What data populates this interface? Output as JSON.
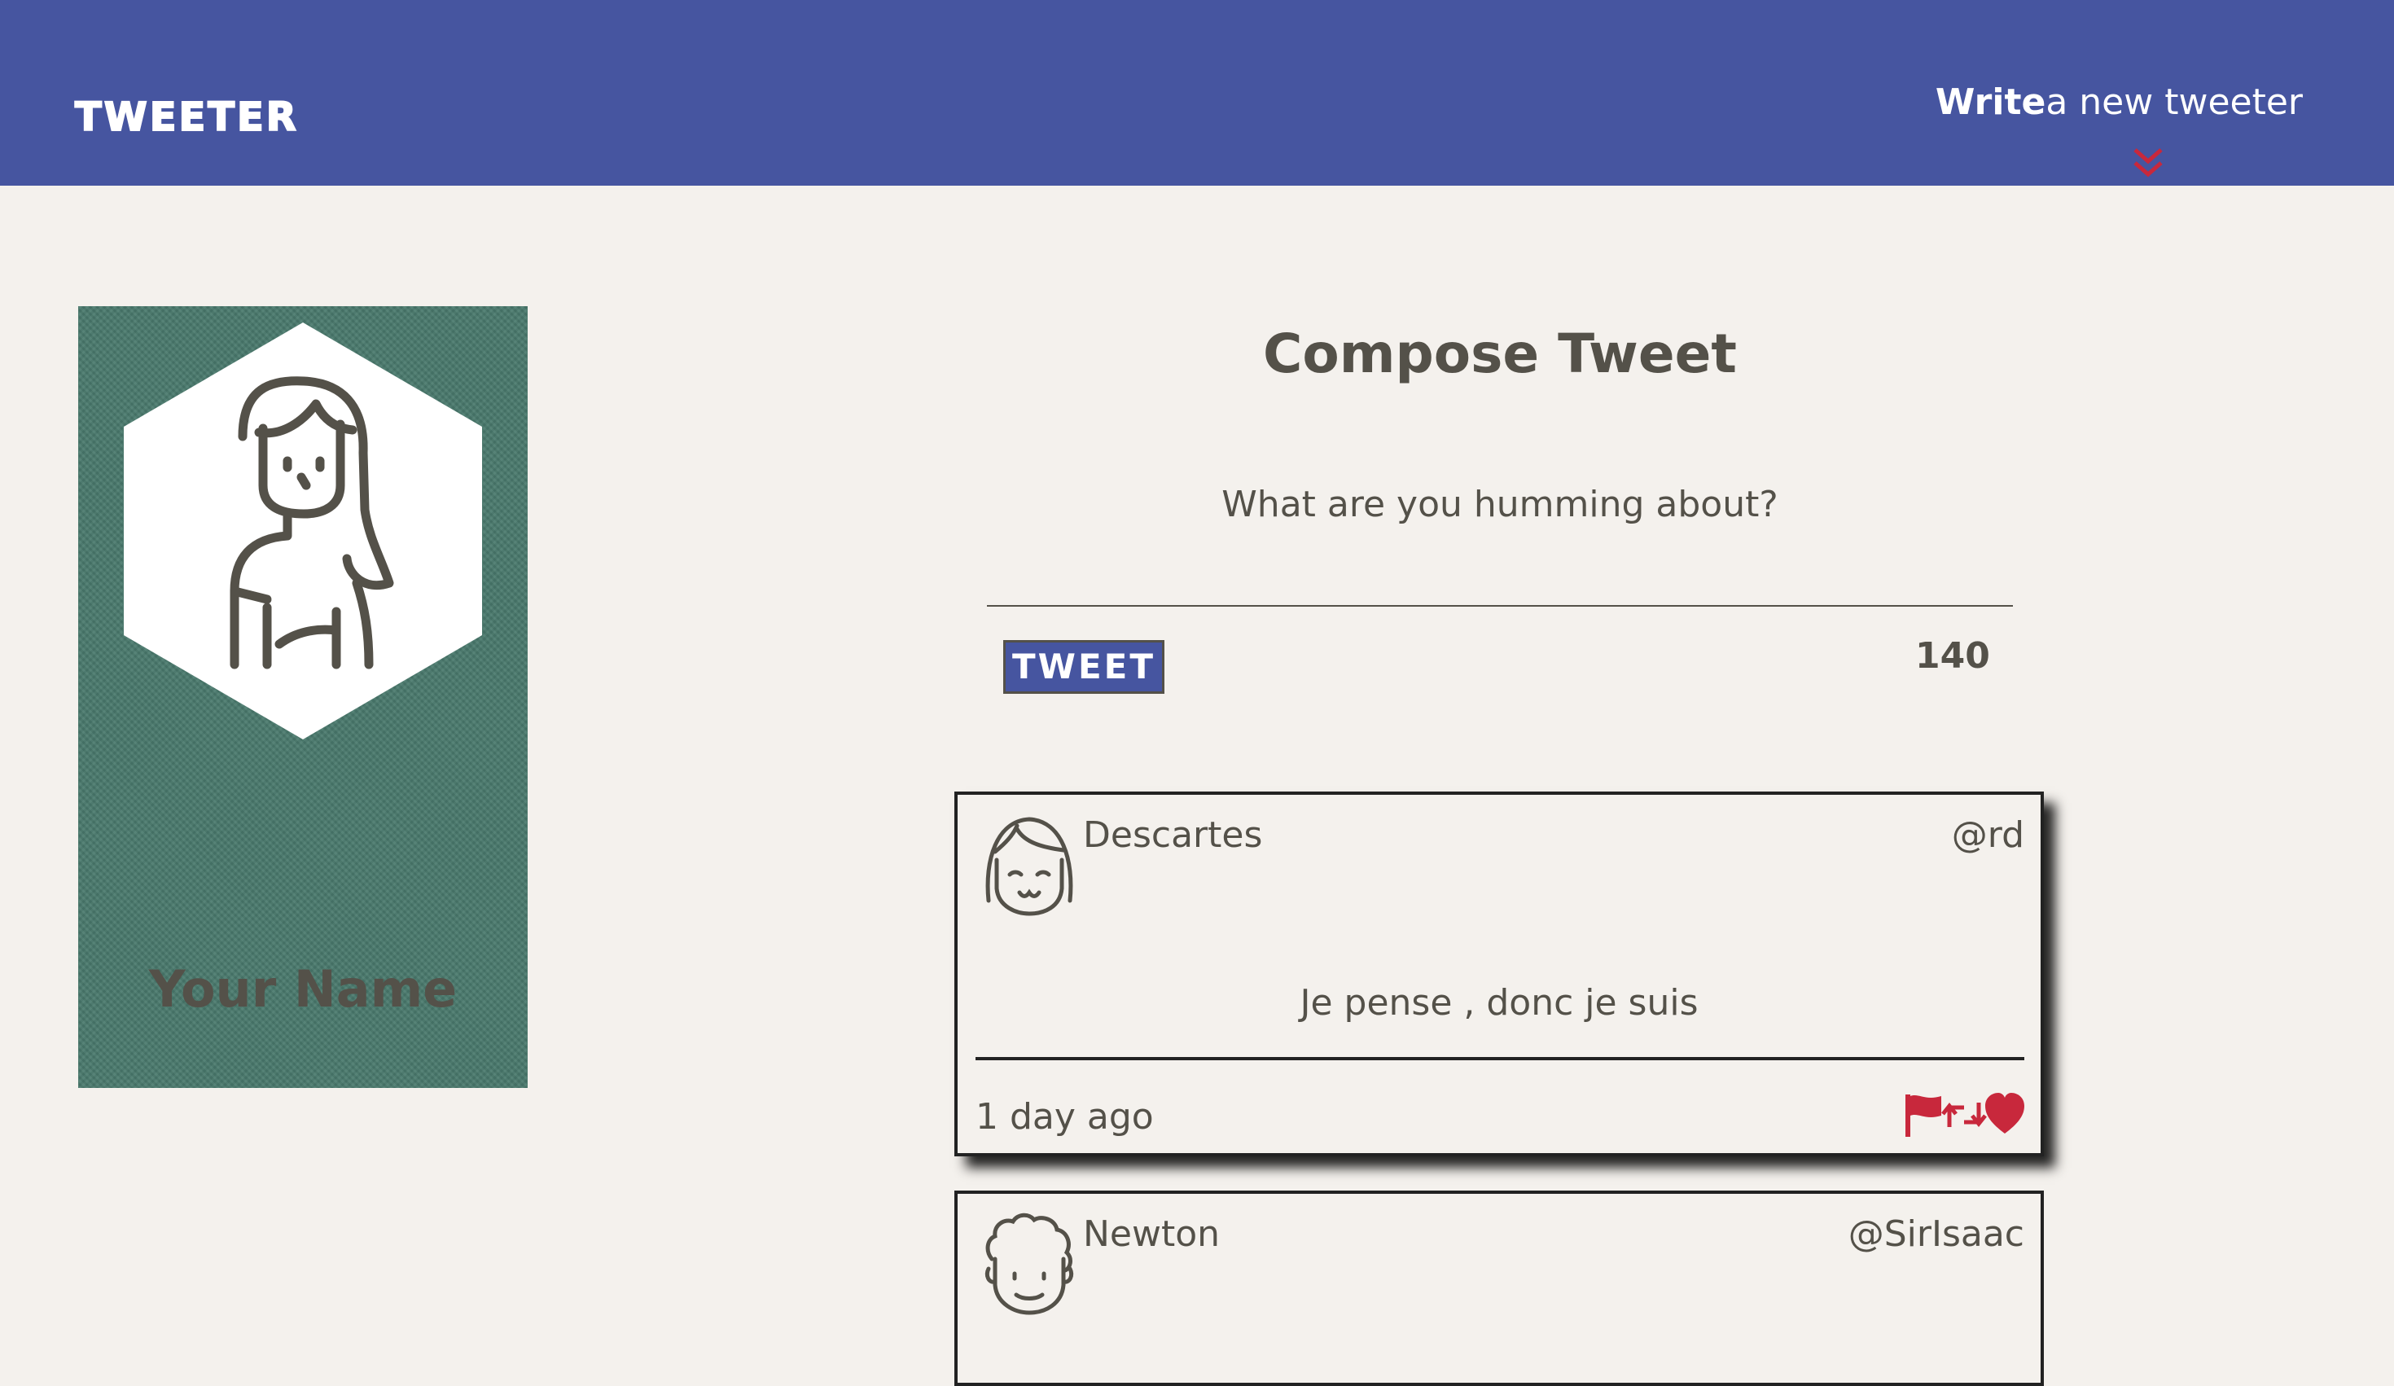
{
  "header": {
    "logo": "TWEETER",
    "write_bold": "Write",
    "write_rest": "a new tweeter"
  },
  "profile": {
    "name": "Your Name"
  },
  "compose": {
    "title": "Compose Tweet",
    "placeholder": "What are you humming about?",
    "button_label": "TWEET",
    "counter": "140"
  },
  "tweets": [
    {
      "author": "Descartes",
      "handle": "@rd",
      "content": "Je pense , donc je suis",
      "timestamp": "1 day ago"
    },
    {
      "author": "Newton",
      "handle": "@SirIsaac"
    }
  ],
  "colors": {
    "nav": "#4655a0",
    "background": "#f4f1ed",
    "profile": "#4a7a6d",
    "accent": "#c8283c",
    "text": "#545149"
  },
  "icons": [
    "double-chevron-down-icon",
    "avatar-illustration",
    "flag-icon",
    "retweet-icon",
    "heart-icon"
  ]
}
